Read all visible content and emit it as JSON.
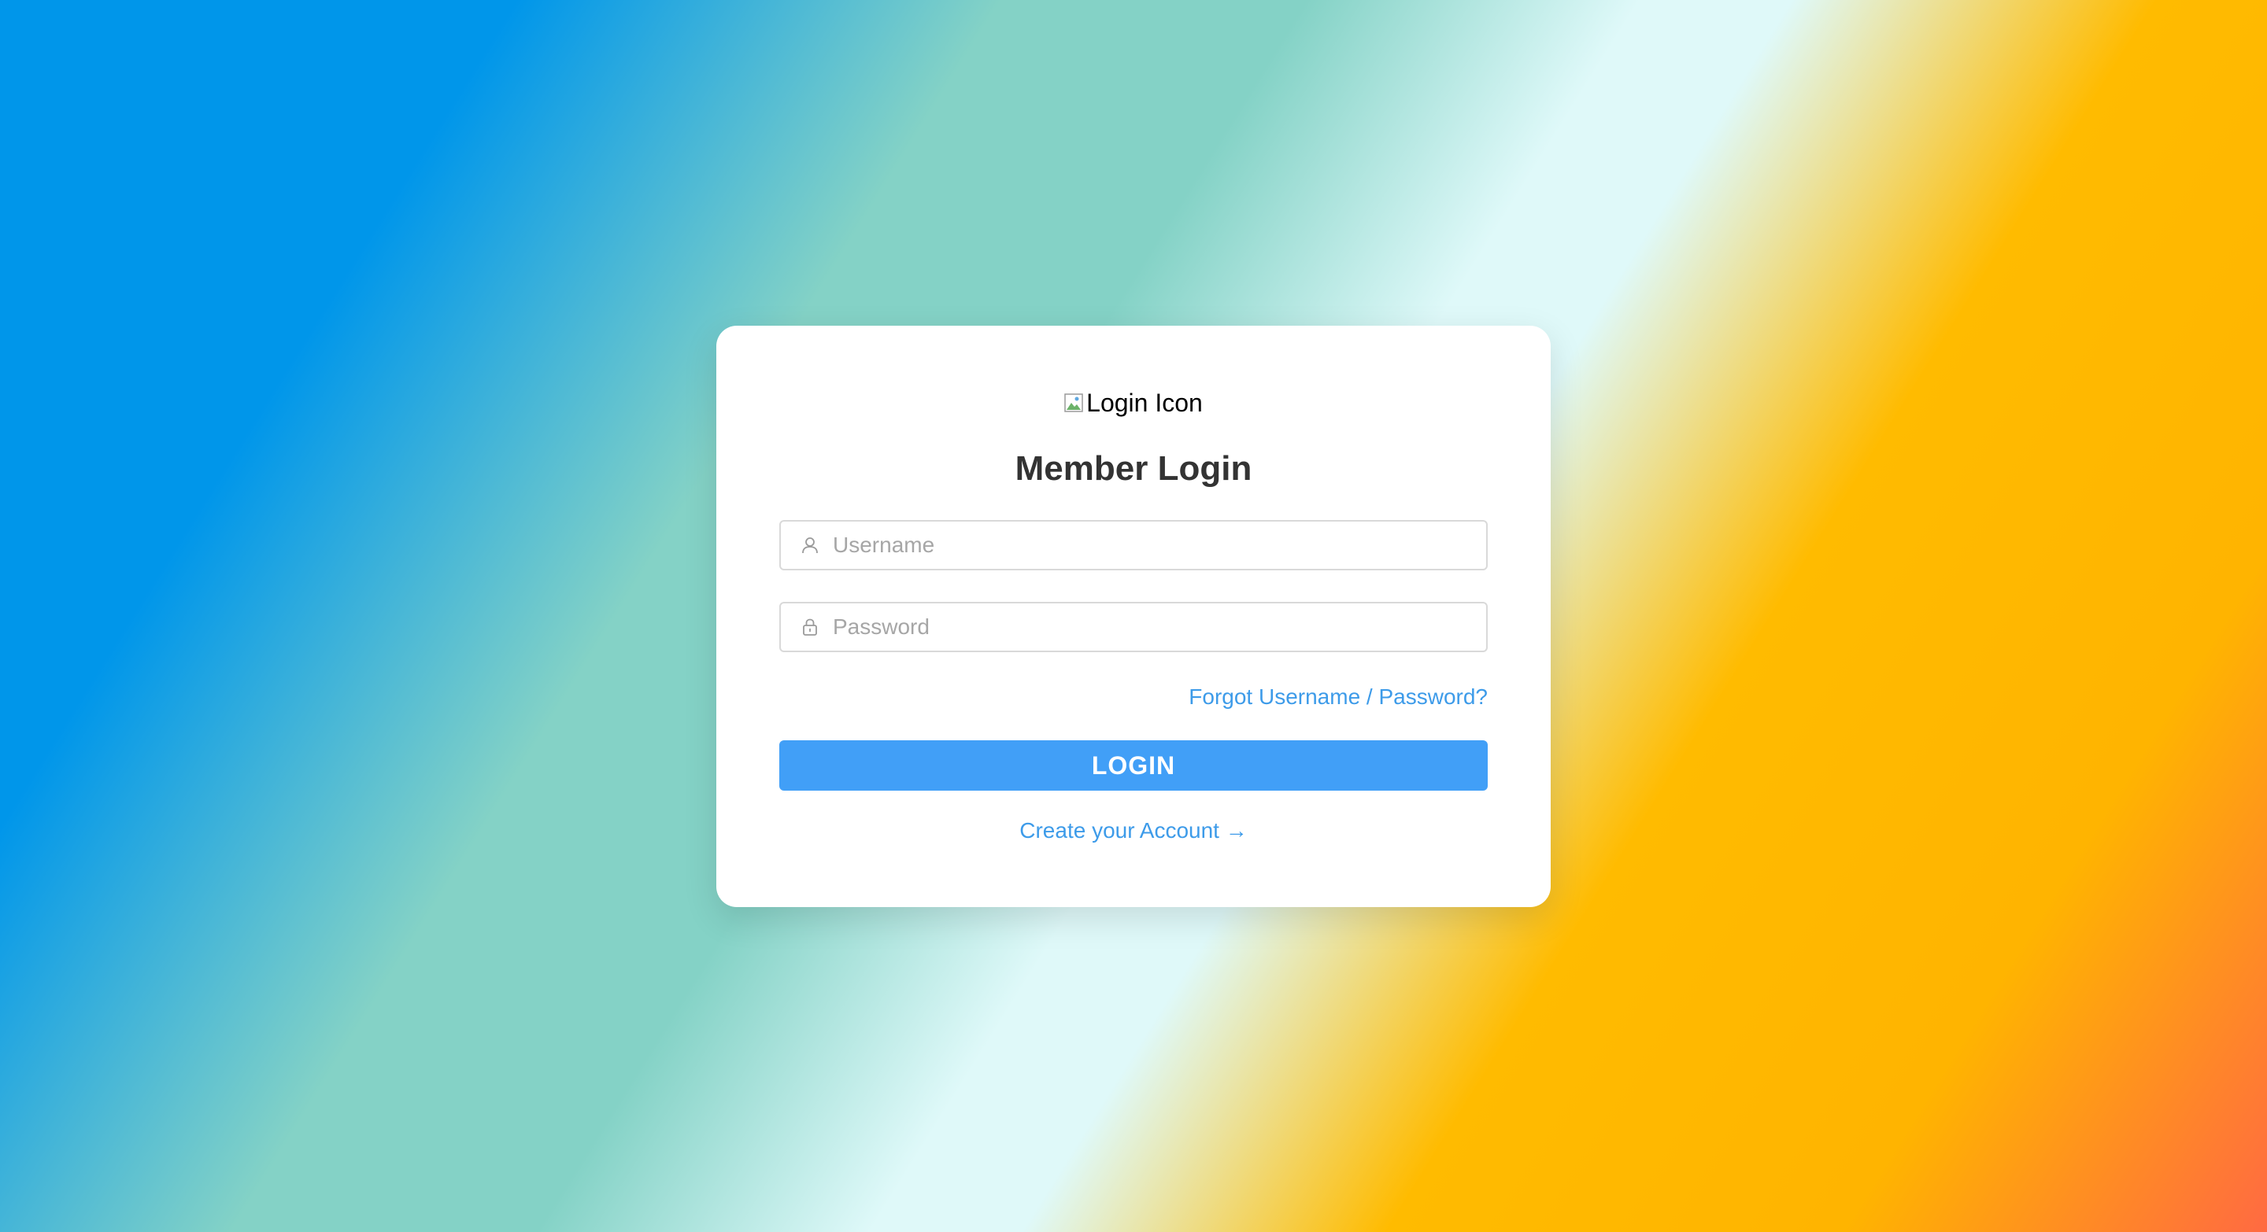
{
  "background": {
    "colors": [
      "#0096ea",
      "#84d2c6",
      "#dff9f9",
      "#ffbb00",
      "#ff6a42"
    ]
  },
  "login_card": {
    "logo_alt": "Login Icon",
    "title": "Member Login",
    "username": {
      "placeholder": "Username",
      "value": "",
      "icon": "user-icon"
    },
    "password": {
      "placeholder": "Password",
      "value": "",
      "icon": "lock-icon"
    },
    "forgot_link": "Forgot Username / Password?",
    "login_button": "LOGIN",
    "create_account_link": "Create your Account →",
    "accent_color": "#419ff7",
    "link_color": "#3d9be9"
  }
}
